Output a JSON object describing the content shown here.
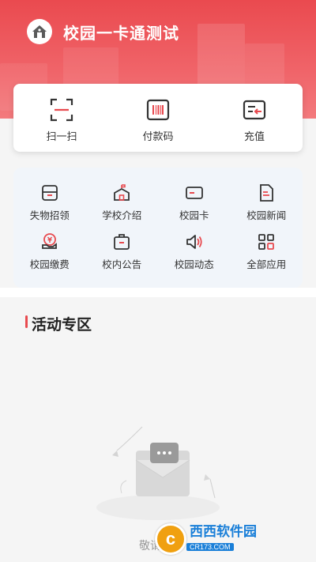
{
  "header": {
    "title": "校园一卡通测试"
  },
  "quick_actions": [
    {
      "label": "扫一扫",
      "icon": "scan-icon"
    },
    {
      "label": "付款码",
      "icon": "barcode-icon"
    },
    {
      "label": "充值",
      "icon": "recharge-icon"
    }
  ],
  "services": [
    {
      "label": "失物招领",
      "icon": "lost-found-icon"
    },
    {
      "label": "学校介绍",
      "icon": "school-icon"
    },
    {
      "label": "校园卡",
      "icon": "card-icon"
    },
    {
      "label": "校园新闻",
      "icon": "news-icon"
    },
    {
      "label": "校园缴费",
      "icon": "payment-icon"
    },
    {
      "label": "校内公告",
      "icon": "notice-icon"
    },
    {
      "label": "校园动态",
      "icon": "speaker-icon"
    },
    {
      "label": "全部应用",
      "icon": "all-apps-icon"
    }
  ],
  "activity": {
    "title": "活动专区",
    "empty_text": "敬请期待"
  },
  "watermark": {
    "logo_char": "c",
    "name": "西西软件园",
    "sub": "CR173.COM"
  },
  "colors": {
    "brand_red": "#ea4a4f",
    "grid_bg": "#f1f5fa"
  }
}
